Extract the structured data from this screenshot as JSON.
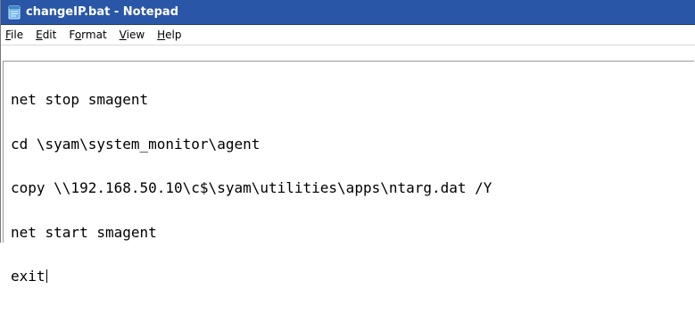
{
  "window": {
    "title": "changeIP.bat - Notepad",
    "icon": "notepad-icon"
  },
  "menu": {
    "items": [
      {
        "accel": "F",
        "rest": "ile"
      },
      {
        "accel": "E",
        "rest": "dit"
      },
      {
        "pre": "F",
        "accel": "o",
        "rest": "rmat"
      },
      {
        "accel": "V",
        "rest": "iew"
      },
      {
        "accel": "H",
        "rest": "elp"
      }
    ]
  },
  "editor": {
    "lines": [
      "net stop smagent",
      "cd \\syam\\system_monitor\\agent",
      "copy \\\\192.168.50.10\\c$\\syam\\utilities\\apps\\ntarg.dat /Y",
      "net start smagent",
      "exit"
    ]
  },
  "colors": {
    "titlebar": "#2a56a8",
    "background": "#ffffff",
    "text": "#000000"
  }
}
